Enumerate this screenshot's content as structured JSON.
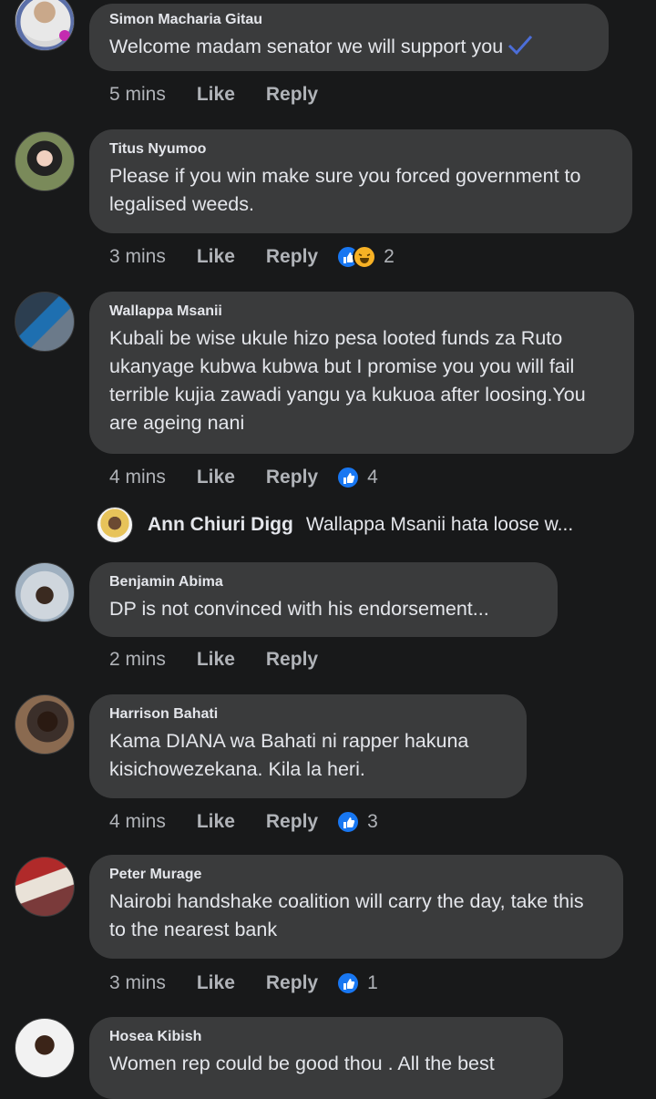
{
  "comments": [
    {
      "author": "Simon Macharia Gitau",
      "text": "Welcome madam senator we will support you",
      "time": "5 mins",
      "like": "Like",
      "reply": "Reply",
      "reaction_count": ""
    },
    {
      "author": "Titus Nyumoo",
      "text": "Please if you win make sure you forced government to legalised weeds.",
      "time": "3 mins",
      "like": "Like",
      "reply": "Reply",
      "reaction_count": "2"
    },
    {
      "author": "Wallappa Msanii",
      "text": "Kubali be wise ukule hizo pesa looted funds za Ruto ukanyage kubwa kubwa but I promise you you will fail terrible kujia zawadi yangu ya kukuoa after loosing.You are ageing nani",
      "time": "4 mins",
      "like": "Like",
      "reply": "Reply",
      "reaction_count": "4"
    },
    {
      "author": "Benjamin Abima",
      "text": "DP is not convinced with his endorsement...",
      "time": "2 mins",
      "like": "Like",
      "reply": "Reply",
      "reaction_count": ""
    },
    {
      "author": "Harrison Bahati",
      "text": "Kama DIANA wa Bahati ni rapper hakuna kisichowezekana. Kila la heri.",
      "time": "4 mins",
      "like": "Like",
      "reply": "Reply",
      "reaction_count": "3"
    },
    {
      "author": "Peter Murage",
      "text": "Nairobi handshake coalition will carry the day, take this to the nearest bank",
      "time": "3 mins",
      "like": "Like",
      "reply": "Reply",
      "reaction_count": "1"
    },
    {
      "author": "Hosea Kibish",
      "text": "Women rep could be good thou . All the best"
    }
  ],
  "sub_reply": {
    "author": "Ann Chiuri Digg",
    "text": "Wallappa Msanii hata loose w..."
  },
  "colors": {
    "background": "#18191a",
    "bubble": "#3a3b3c",
    "text": "#e4e6eb",
    "muted": "#b0b3b8",
    "like_blue": "#1877f2",
    "haha_yellow": "#f7b125"
  },
  "icons": {
    "verified": "checkmark-icon",
    "like_reaction": "like-reaction-icon",
    "haha_reaction": "haha-reaction-icon"
  }
}
